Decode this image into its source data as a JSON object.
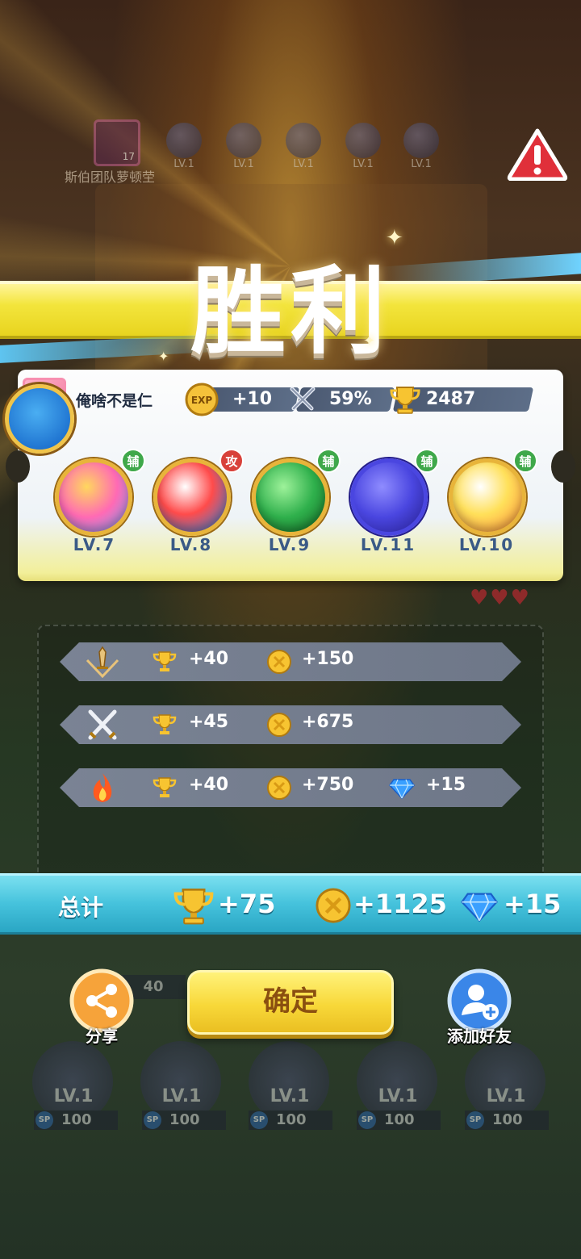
{
  "top_bar": {
    "player_badge_level": "17",
    "opponent_name": "斯伯团队萝顿茔",
    "skill_levels": [
      "LV.1",
      "LV.1",
      "LV.1",
      "LV.1",
      "LV.1"
    ]
  },
  "banner": {
    "title": "胜利"
  },
  "result": {
    "player_name": "俺啥不是仁",
    "exp": {
      "icon": "exp-coin-icon",
      "label": "EXP",
      "value": "+10"
    },
    "win_rate": {
      "icon": "crossed-swords-icon",
      "value": "59%"
    },
    "trophies": {
      "icon": "trophy-icon",
      "value": "2487"
    },
    "skills": [
      {
        "tag": "辅",
        "tag_color": "#3fa84a",
        "level": "LV.7",
        "colors": [
          "#ffd75e",
          "#ff6ab4",
          "#7aa6ff"
        ]
      },
      {
        "tag": "攻",
        "tag_color": "#d8413a",
        "level": "LV.8",
        "colors": [
          "#ff4b4b",
          "#ffffff",
          "#1f8ef0"
        ]
      },
      {
        "tag": "辅",
        "tag_color": "#3fa84a",
        "level": "LV.9",
        "colors": [
          "#2fb04c",
          "#9ef29a",
          "#136b25"
        ]
      },
      {
        "tag": "辅",
        "tag_color": "#3fa84a",
        "level": "LV.11",
        "colors": [
          "#4a46e0",
          "#8f8cff",
          "#241d8a"
        ]
      },
      {
        "tag": "辅",
        "tag_color": "#3fa84a",
        "level": "LV.10",
        "colors": [
          "#ffe05a",
          "#ff8a3a",
          "#ffffff"
        ]
      }
    ]
  },
  "rewards": [
    {
      "icon": "sword-rank-icon",
      "trophy": "+40",
      "coins": "+150",
      "gems": ""
    },
    {
      "icon": "crossed-swords-icon",
      "trophy": "+45",
      "coins": "+675",
      "gems": ""
    },
    {
      "icon": "flame-icon",
      "trophy": "+40",
      "coins": "+750",
      "gems": "+15"
    }
  ],
  "total": {
    "label": "总计",
    "trophy": "+75",
    "coins": "+1125",
    "gems": "+15"
  },
  "actions": {
    "share_label": "分享",
    "confirm_label": "确定",
    "add_friend_label": "添加好友"
  },
  "bottom_ghost": {
    "counter": "40",
    "levels": [
      "LV.1",
      "LV.1",
      "LV.1",
      "LV.1",
      "LV.1"
    ],
    "sp_values": [
      "100",
      "100",
      "100",
      "100",
      "100"
    ],
    "sp_label": "SP"
  },
  "colors": {
    "banner_yellow": "#f3e53c",
    "total_bar": "#45c2dc",
    "confirm_button": "#f8d839",
    "warning_red": "#e0303a"
  }
}
